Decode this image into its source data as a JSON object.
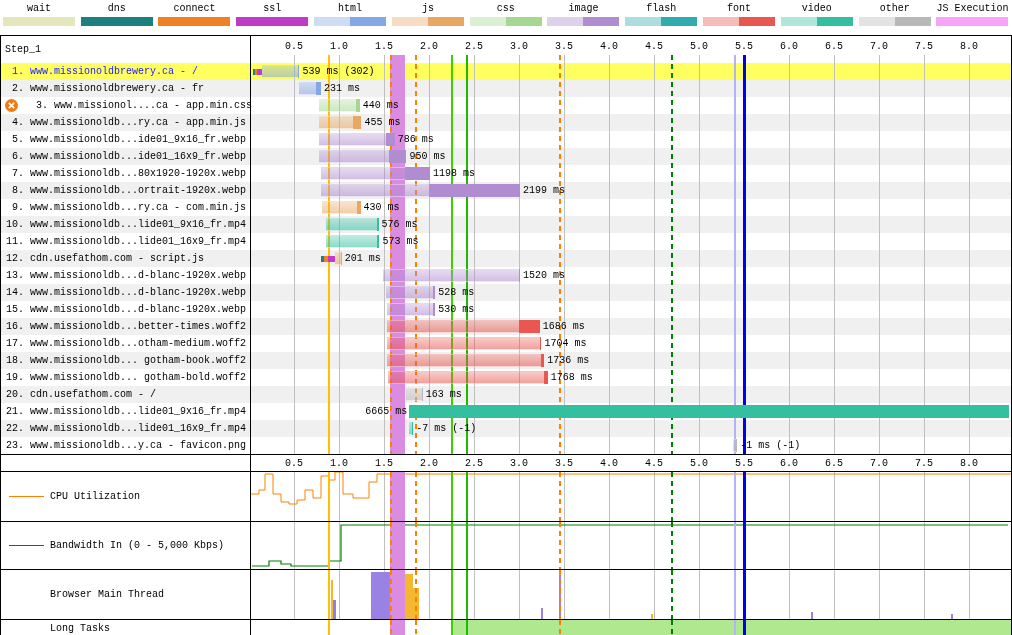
{
  "legend": [
    {
      "label": "wait",
      "color": "#e6e6bc",
      "kind": "timing"
    },
    {
      "label": "dns",
      "color": "#1c8080",
      "kind": "timing"
    },
    {
      "label": "connect",
      "color": "#f08024",
      "kind": "timing"
    },
    {
      "label": "ssl",
      "color": "#c03cc8",
      "kind": "timing"
    },
    {
      "label": "html",
      "color": "#84a8e4",
      "kind": "resource"
    },
    {
      "label": "js",
      "color": "#e8a864",
      "kind": "resource"
    },
    {
      "label": "css",
      "color": "#a4d890",
      "kind": "resource"
    },
    {
      "label": "image",
      "color": "#b08cd0",
      "kind": "resource"
    },
    {
      "label": "flash",
      "color": "#30acb0",
      "kind": "resource"
    },
    {
      "label": "font",
      "color": "#e85850",
      "kind": "resource"
    },
    {
      "label": "video",
      "color": "#34c0a0",
      "kind": "resource"
    },
    {
      "label": "other",
      "color": "#b8b8b8",
      "kind": "resource"
    },
    {
      "label": "JS Execution",
      "color": "#f8a4f8",
      "kind": "timing"
    }
  ],
  "waterfall": {
    "step": "Step_1",
    "requests": [
      {
        "number": "1.",
        "url": "www.missionoldbrewery.ca - /",
        "duration": "539 ms (302)",
        "color": "#84a8e4",
        "selected": true,
        "error": false
      },
      {
        "number": "2.",
        "url": "www.missionoldbrewery.ca - fr",
        "duration": "231 ms",
        "color": "#84a8e4",
        "selected": false,
        "error": false
      },
      {
        "number": "3.",
        "url": "www.missionol....ca - app.min.css",
        "duration": "440 ms",
        "color": "#a4d890",
        "selected": false,
        "error": true
      },
      {
        "number": "4.",
        "url": "www.missionoldb...ry.ca - app.min.js",
        "duration": "455 ms",
        "color": "#e8a864",
        "selected": false,
        "error": false
      },
      {
        "number": "5.",
        "url": "www.missionoldb...ide01_9x16_fr.webp",
        "duration": "786 ms",
        "color": "#b08cd0",
        "selected": false,
        "error": false
      },
      {
        "number": "6.",
        "url": "www.missionoldb...ide01_16x9_fr.webp",
        "duration": "950 ms",
        "color": "#b08cd0",
        "selected": false,
        "error": false
      },
      {
        "number": "7.",
        "url": "www.missionoldb...80x1920-1920x.webp",
        "duration": "1198 ms",
        "color": "#b08cd0",
        "selected": false,
        "error": false
      },
      {
        "number": "8.",
        "url": "www.missionoldb...ortrait-1920x.webp",
        "duration": "2199 ms",
        "color": "#b08cd0",
        "selected": false,
        "error": false
      },
      {
        "number": "9.",
        "url": "www.missionoldb...ry.ca - com.min.js",
        "duration": "430 ms",
        "color": "#e8a864",
        "selected": false,
        "error": false
      },
      {
        "number": "10.",
        "url": "www.missionoldb...lide01_9x16_fr.mp4",
        "duration": "576 ms",
        "color": "#34c0a0",
        "selected": false,
        "error": false
      },
      {
        "number": "11.",
        "url": "www.missionoldb...lide01_16x9_fr.mp4",
        "duration": "573 ms",
        "color": "#34c0a0",
        "selected": false,
        "error": false
      },
      {
        "number": "12.",
        "url": "cdn.usefathom.com - script.js",
        "duration": "201 ms",
        "color": "#e8a864",
        "selected": false,
        "error": false
      },
      {
        "number": "13.",
        "url": "www.missionoldb...d-blanc-1920x.webp",
        "duration": "1520 ms",
        "color": "#b08cd0",
        "selected": false,
        "error": false
      },
      {
        "number": "14.",
        "url": "www.missionoldb...d-blanc-1920x.webp",
        "duration": "528 ms",
        "color": "#b08cd0",
        "selected": false,
        "error": false
      },
      {
        "number": "15.",
        "url": "www.missionoldb...d-blanc-1920x.webp",
        "duration": "530 ms",
        "color": "#b08cd0",
        "selected": false,
        "error": false
      },
      {
        "number": "16.",
        "url": "www.missionoldb...better-times.woff2",
        "duration": "1686 ms",
        "color": "#e85850",
        "selected": false,
        "error": false
      },
      {
        "number": "17.",
        "url": "www.missionoldb...otham-medium.woff2",
        "duration": "1704 ms",
        "color": "#e85850",
        "selected": false,
        "error": false
      },
      {
        "number": "18.",
        "url": "www.missionoldb... gotham-book.woff2",
        "duration": "1736 ms",
        "color": "#e85850",
        "selected": false,
        "error": false
      },
      {
        "number": "19.",
        "url": "www.missionoldb... gotham-bold.woff2",
        "duration": "1768 ms",
        "color": "#e85850",
        "selected": false,
        "error": false
      },
      {
        "number": "20.",
        "url": "cdn.usefathom.com - /",
        "duration": "163 ms",
        "color": "#b8b8b8",
        "selected": false,
        "error": false
      },
      {
        "number": "21.",
        "url": "www.missionoldb...lide01_9x16_fr.mp4",
        "duration": "6665 ms",
        "color": "#34c0a0",
        "selected": false,
        "error": false
      },
      {
        "number": "22.",
        "url": "www.missionoldb...lide01_16x9_fr.mp4",
        "duration": "-7 ms (-1)",
        "color": "#34c0a0",
        "selected": false,
        "error": false
      },
      {
        "number": "23.",
        "url": "www.missionoldb...y.ca - favicon.png",
        "duration": "-1 ms (-1)",
        "color": "#b8b8b8",
        "selected": false,
        "error": false
      }
    ],
    "ticks": [
      "0.5",
      "1.0",
      "1.5",
      "2.0",
      "2.5",
      "3.0",
      "3.5",
      "4.0",
      "4.5",
      "5.0",
      "5.5",
      "6.0",
      "6.5",
      "7.0",
      "7.5",
      "8.0"
    ]
  },
  "timeline": {
    "ticks": [
      "0.5",
      "1.0",
      "1.5",
      "2.0",
      "2.5",
      "3.0",
      "3.5",
      "4.0",
      "4.5",
      "5.0",
      "5.5",
      "6.0",
      "6.5",
      "7.0",
      "7.5",
      "8.0"
    ],
    "panels": [
      {
        "label": "CPU Utilization",
        "kind": "cpu",
        "color": "#ff8000"
      },
      {
        "label": "Bandwidth In (0 - 5,000 Kbps)",
        "kind": "bandwidth",
        "color": "#008000"
      },
      {
        "label": "Browser Main Thread",
        "kind": "main_thread"
      },
      {
        "label": "Long Tasks",
        "kind": "long_tasks"
      }
    ]
  }
}
